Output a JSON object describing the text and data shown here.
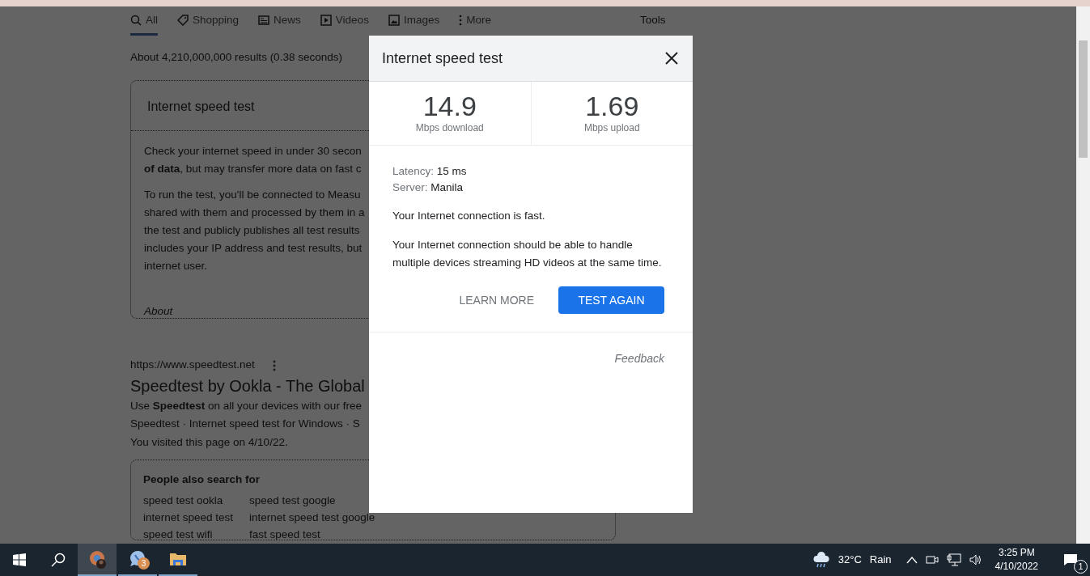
{
  "search_tabs": [
    {
      "label": "All",
      "selected": true
    },
    {
      "label": "Shopping",
      "selected": false
    },
    {
      "label": "News",
      "selected": false
    },
    {
      "label": "Videos",
      "selected": false
    },
    {
      "label": "Images",
      "selected": false
    },
    {
      "label": "More",
      "selected": false
    }
  ],
  "tools": "Tools",
  "result_stats": "About 4,210,000,000 results (0.38 seconds)",
  "featured_card": {
    "title": "Internet speed test",
    "paragraphs": [
      [
        "Check your internet speed in under 30 secon",
        "**of data**, but may transfer more data on fast c"
      ],
      [
        "To run the test, you'll be connected to Measu",
        "shared with them and processed by them in a",
        "the test and publicly publishes all test results",
        "includes your IP address and test results, but",
        "internet user."
      ]
    ],
    "about": "About"
  },
  "result": {
    "url": "https://www.speedtest.net",
    "title": "Speedtest by Ookla - The Global",
    "lines": [
      "Use **Speedtest** on all your devices with our free",
      "Speedtest · Internet speed test for Windows · S",
      "You visited this page on 4/10/22."
    ]
  },
  "people_also_search": {
    "title": "People also search for",
    "items": [
      [
        "speed test ookla",
        "speed test google"
      ],
      [
        "internet speed test",
        "internet speed test google"
      ],
      [
        "speed test wifi",
        "fast speed test"
      ]
    ]
  },
  "dialog": {
    "title": "Internet speed test",
    "results": [
      {
        "value": "14.9",
        "unit": "Mbps download"
      },
      {
        "value": "1.69",
        "unit": "Mbps upload"
      }
    ],
    "details": [
      {
        "label": "Latency:",
        "value": "15 ms"
      },
      {
        "label": "Server:",
        "value": "Manila"
      }
    ],
    "messages": [
      "Your Internet connection is fast.",
      "Your Internet connection should be able to handle multiple devices streaming HD videos at the same time."
    ],
    "buttons": [
      {
        "label": "LEARN MORE",
        "kind": "text"
      },
      {
        "label": "TEST AGAIN",
        "kind": "primary"
      }
    ],
    "feedback": "Feedback"
  },
  "taskbar": {
    "apps": [
      {
        "kind": "browser",
        "active": true
      },
      {
        "kind": "chat",
        "badge": "3",
        "active": false
      },
      {
        "kind": "folder",
        "active": false
      }
    ],
    "weather": {
      "temperature": "32°C",
      "condition": "Rain"
    },
    "time": "3:25 PM",
    "date": "4/10/2022",
    "notifications": "1"
  }
}
